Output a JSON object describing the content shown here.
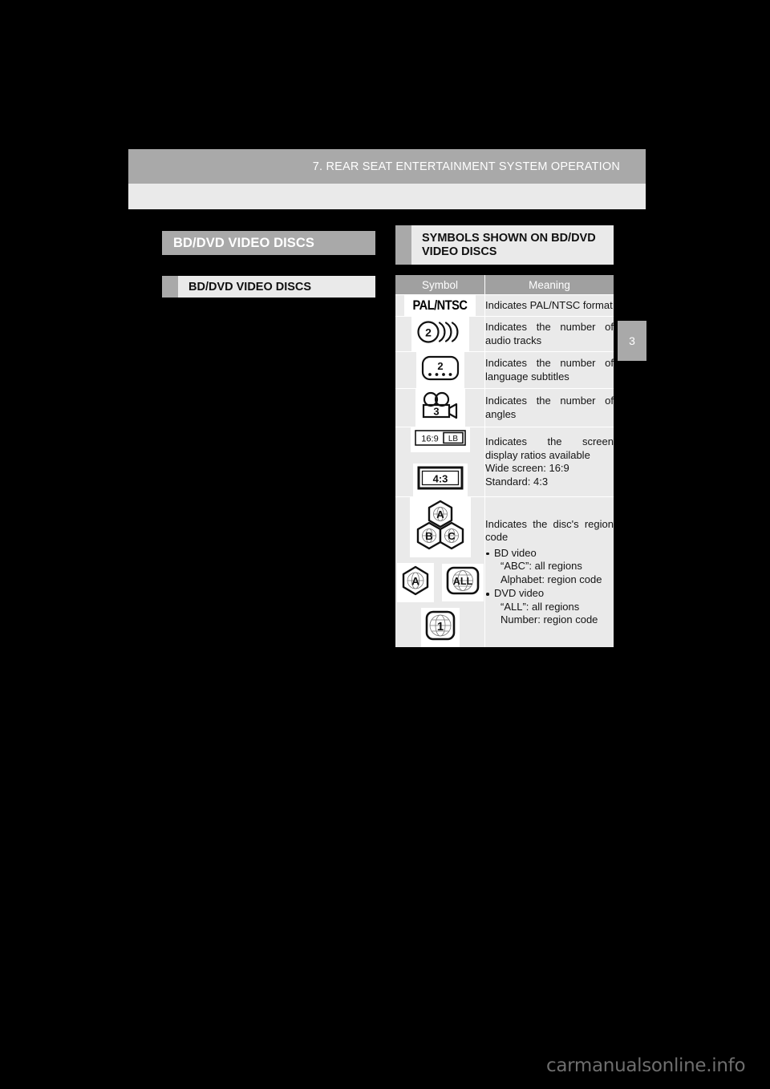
{
  "page": {
    "header_title": "7. REAR SEAT ENTERTAINMENT SYSTEM OPERATION",
    "chapter_tab": "3",
    "watermark": "carmanualsonline.info"
  },
  "left_column": {
    "section_title": "BD/DVD VIDEO DISCS",
    "subsection_title": "BD/DVD VIDEO DISCS"
  },
  "right_column": {
    "heading": "SYMBOLS SHOWN ON BD/DVD VIDEO DISCS",
    "table": {
      "columns": [
        "Symbol",
        "Meaning"
      ],
      "rows": [
        {
          "symbol_name": "pal-ntsc-symbol",
          "symbol_text": "PAL/NTSC",
          "meaning": "Indicates PAL/NTSC format"
        },
        {
          "symbol_name": "audio-tracks-symbol",
          "symbol_text": "2",
          "meaning": "Indicates the number of audio tracks"
        },
        {
          "symbol_name": "language-subtitles-symbol",
          "symbol_text": "2",
          "meaning": "Indicates the number of language subtitles"
        },
        {
          "symbol_name": "camera-angles-symbol",
          "symbol_text": "3",
          "meaning": "Indicates the number of angles"
        },
        {
          "symbol_name": "aspect-ratio-symbol",
          "symbol_text_1": "16:9",
          "symbol_text_2": "LB",
          "symbol_text_3": "4:3",
          "meaning_line1": "Indicates the screen display ratios available",
          "meaning_line2": "Wide screen: 16:9",
          "meaning_line3": "Standard: 4:3"
        },
        {
          "symbol_name": "region-code-symbol",
          "symbol_text_a": "A",
          "symbol_text_b": "B",
          "symbol_text_c": "C",
          "symbol_text_all": "ALL",
          "symbol_text_num": "1",
          "meaning_line1": "Indicates the disc's region code",
          "bullets": [
            {
              "title": "BD video",
              "line1": "“ABC”: all regions",
              "line2": "Alphabet: region code"
            },
            {
              "title": "DVD video",
              "line1": "“ALL”: all regions",
              "line2": "Number: region code"
            }
          ]
        }
      ]
    }
  },
  "colors": {
    "page_background": "#000000",
    "band_gray": "#a9a9a9",
    "panel_gray": "#eaeaea",
    "table_header_gray": "#a0a0a0"
  }
}
